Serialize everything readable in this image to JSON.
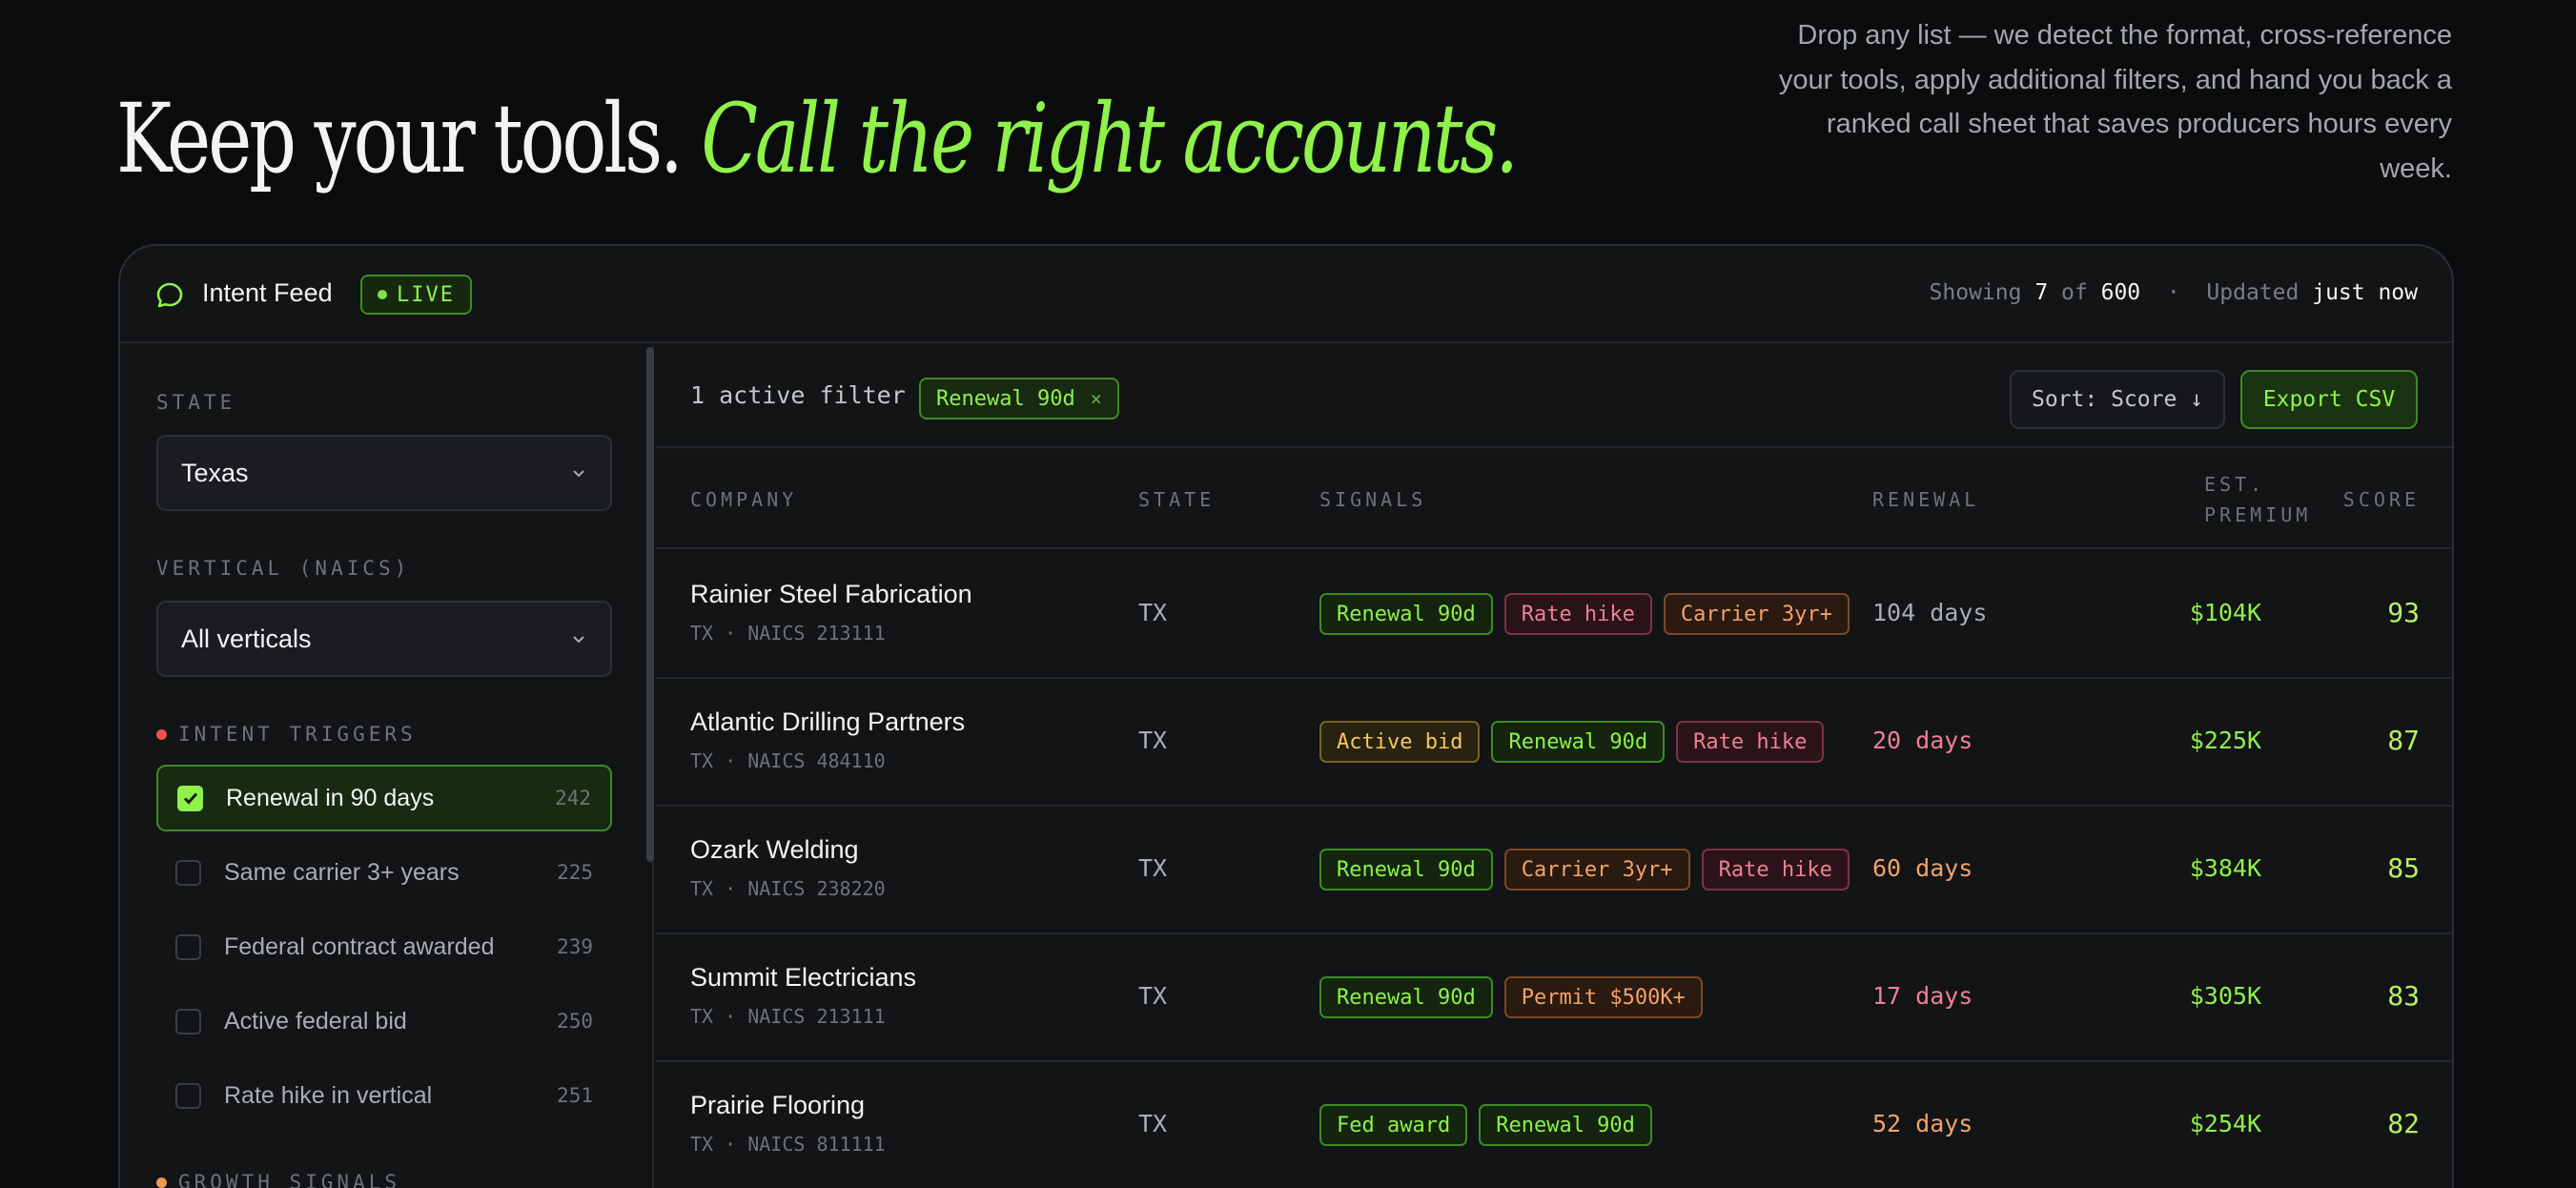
{
  "hero": {
    "title_plain": "Keep your tools.",
    "title_accent": "Call the right accounts.",
    "description": "Drop any list — we detect the format, cross-reference your tools, apply additional filters, and hand you back a ranked call sheet that saves producers hours every week."
  },
  "colors": {
    "accent": "#8ef24a",
    "background": "#0b0c0d",
    "card": "#121416",
    "warning_red": "#f07f93",
    "warning_orange": "#f3a26a",
    "warning_yellow": "#f2c85b"
  },
  "header": {
    "title": "Intent Feed",
    "icon": "chat-bubble-icon",
    "live_label": "LIVE",
    "showing_label": "Showing",
    "showing_count": "7",
    "of_label": "of",
    "total": "600",
    "separator": "·",
    "updated_label": "Updated",
    "updated_value": "just now"
  },
  "sidebar": {
    "state_label": "STATE",
    "state_value": "Texas",
    "vertical_label": "VERTICAL (NAICS)",
    "vertical_value": "All verticals",
    "triggers_label": "INTENT TRIGGERS",
    "triggers": [
      {
        "label": "Renewal in 90 days",
        "count": "242",
        "checked": true
      },
      {
        "label": "Same carrier 3+ years",
        "count": "225",
        "checked": false
      },
      {
        "label": "Federal contract awarded",
        "count": "239",
        "checked": false
      },
      {
        "label": "Active federal bid",
        "count": "250",
        "checked": false
      },
      {
        "label": "Rate hike in vertical",
        "count": "251",
        "checked": false
      }
    ],
    "growth_label": "GROWTH SIGNALS"
  },
  "filters": {
    "active_count_text": "1 active filter",
    "chip_label": "Renewal 90d",
    "chip_remove": "×",
    "sort_label": "Sort: Score ↓",
    "export_label": "Export CSV"
  },
  "table": {
    "columns": {
      "company": "COMPANY",
      "state": "STATE",
      "signals": "SIGNALS",
      "renewal": "RENEWAL",
      "premium_line1": "EST.",
      "premium_line2": "PREMIUM",
      "score": "SCORE"
    },
    "rows": [
      {
        "company": "Rainier Steel Fabrication",
        "meta": "TX · NAICS 213111",
        "state": "TX",
        "signals": [
          {
            "label": "Renewal 90d",
            "tone": "green"
          },
          {
            "label": "Rate hike",
            "tone": "red"
          },
          {
            "label": "Carrier 3yr+",
            "tone": "orange"
          }
        ],
        "renewal": "104 days",
        "renewal_color": "#a9acb1",
        "premium": "$104K",
        "score": "93"
      },
      {
        "company": "Atlantic Drilling Partners",
        "meta": "TX · NAICS 484110",
        "state": "TX",
        "signals": [
          {
            "label": "Active bid",
            "tone": "yellow"
          },
          {
            "label": "Renewal 90d",
            "tone": "green"
          },
          {
            "label": "Rate hike",
            "tone": "red"
          }
        ],
        "renewal": "20 days",
        "renewal_color": "#f07f93",
        "premium": "$225K",
        "score": "87"
      },
      {
        "company": "Ozark Welding",
        "meta": "TX · NAICS 238220",
        "state": "TX",
        "signals": [
          {
            "label": "Renewal 90d",
            "tone": "green"
          },
          {
            "label": "Carrier 3yr+",
            "tone": "orange"
          },
          {
            "label": "Rate hike",
            "tone": "red"
          }
        ],
        "renewal": "60 days",
        "renewal_color": "#f3a26a",
        "premium": "$384K",
        "score": "85"
      },
      {
        "company": "Summit Electricians",
        "meta": "TX · NAICS 213111",
        "state": "TX",
        "signals": [
          {
            "label": "Renewal 90d",
            "tone": "green"
          },
          {
            "label": "Permit $500K+",
            "tone": "orange"
          }
        ],
        "renewal": "17 days",
        "renewal_color": "#f07f93",
        "premium": "$305K",
        "score": "83"
      },
      {
        "company": "Prairie Flooring",
        "meta": "TX · NAICS 811111",
        "state": "TX",
        "signals": [
          {
            "label": "Fed award",
            "tone": "green"
          },
          {
            "label": "Renewal 90d",
            "tone": "green"
          }
        ],
        "renewal": "52 days",
        "renewal_color": "#f3a26a",
        "premium": "$254K",
        "score": "82"
      }
    ]
  }
}
